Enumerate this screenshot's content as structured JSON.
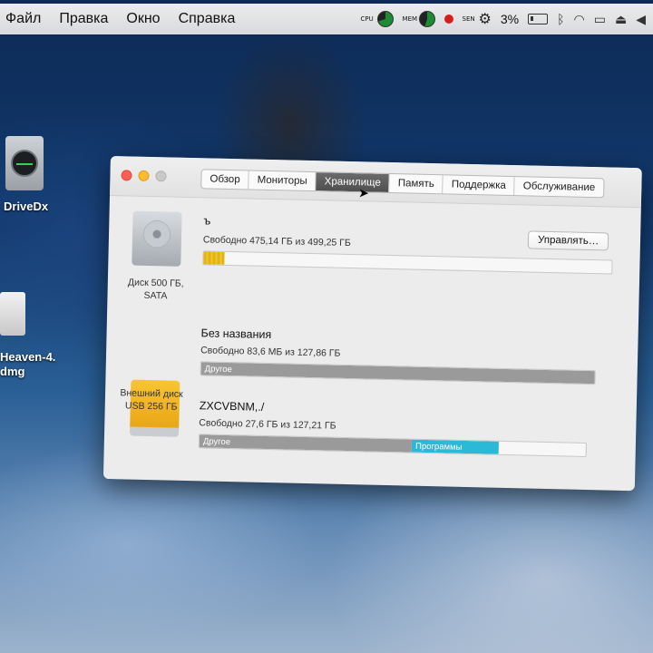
{
  "menubar": {
    "items": [
      "Файл",
      "Правка",
      "Окно",
      "Справка"
    ],
    "tray": {
      "cpu_label": "CPU",
      "mem_label": "MEM",
      "sen_label": "SEN",
      "battery_percent": "3%",
      "icons": [
        "cpu-pie-icon",
        "mem-pie-icon",
        "record-icon",
        "gear-icon",
        "battery-icon",
        "bluetooth-icon",
        "wifi-icon",
        "airplay-icon",
        "eject-icon",
        "volume-icon"
      ]
    }
  },
  "desktop": {
    "icons": [
      {
        "label": "DriveDx"
      },
      {
        "label_line1": "Heaven-4.",
        "label_line2": "dmg"
      }
    ]
  },
  "window": {
    "tabs": [
      "Обзор",
      "Мониторы",
      "Хранилище",
      "Память",
      "Поддержка",
      "Обслуживание"
    ],
    "active_tab": "Хранилище",
    "disks": [
      {
        "caption_line1": "Диск 500 ГБ,",
        "caption_line2": "SATA",
        "volumes": [
          {
            "name": "ъ",
            "free": "Свободно 475,14 ГБ из 499,25 ГБ",
            "manage_label": "Управлять…",
            "segments": [
              {
                "label": "",
                "fraction": 0.05,
                "color": "#e2b413"
              }
            ]
          }
        ]
      },
      {
        "caption_line1": "Внешний диск",
        "caption_line2": "USB 256 ГБ",
        "volumes": [
          {
            "name": "Без названия",
            "free": "Свободно 83,6 МБ из 127,86 ГБ",
            "segments": [
              {
                "label": "Другое",
                "fraction": 1.0,
                "color": "#9a9a9a"
              }
            ]
          },
          {
            "name": "ZXCVBNM,./",
            "free": "Свободно 27,6 ГБ из 127,21 ГБ",
            "segments": [
              {
                "label": "Другое",
                "fraction": 0.55,
                "color": "#9a9a9a"
              },
              {
                "label": "Программы",
                "fraction": 0.225,
                "color": "#2cb9d8"
              }
            ]
          }
        ]
      }
    ]
  }
}
